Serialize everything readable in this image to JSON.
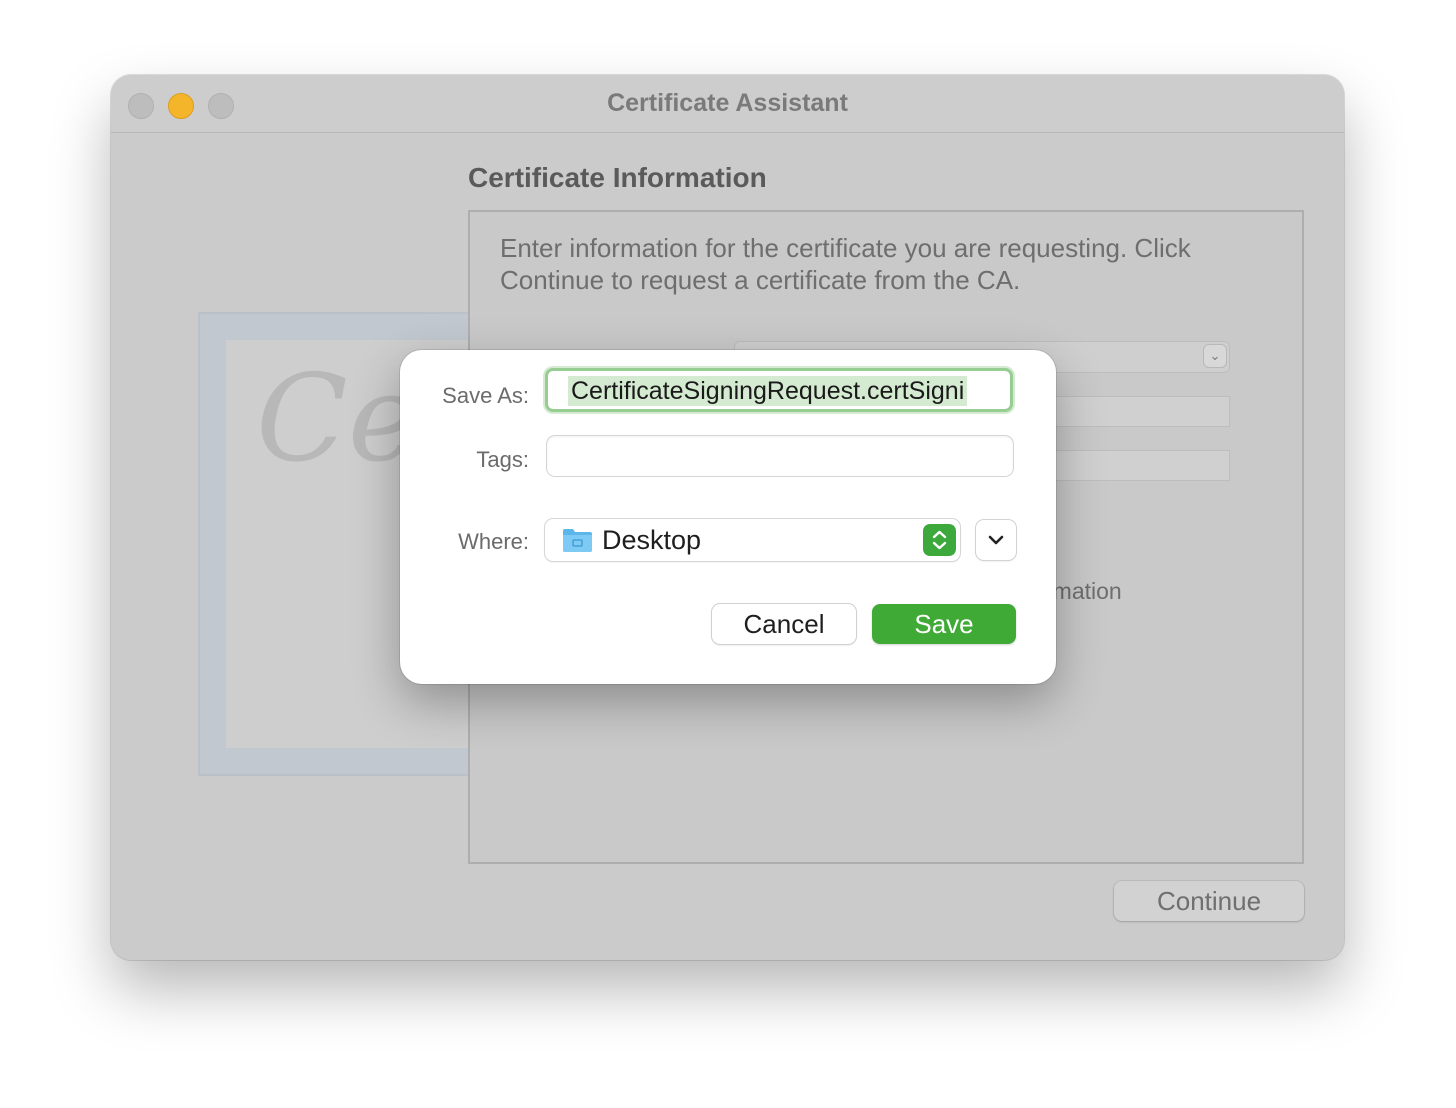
{
  "window": {
    "title": "Certificate Assistant"
  },
  "background": {
    "section_title": "Certificate Information",
    "instructions": "Enter information for the certificate you are requesting. Click Continue to request a certificate from the CA.",
    "partial_option_text": "rmation",
    "certificate_image_text": "Ce",
    "continue_label": "Continue"
  },
  "save_dialog": {
    "save_as_label": "Save As:",
    "save_as_value": "CertificateSigningRequest.certSigni",
    "tags_label": "Tags:",
    "tags_value": "",
    "where_label": "Where:",
    "where_value": "Desktop",
    "cancel_label": "Cancel",
    "save_label": "Save"
  },
  "colors": {
    "accent_green": "#40aa37",
    "focus_ring": "#97cc92",
    "minimize_yellow": "#f5b52b"
  },
  "icons": {
    "where_folder": "folder-icon",
    "where_stepper": "up-down-chevron-icon",
    "expand": "chevron-down-icon"
  }
}
